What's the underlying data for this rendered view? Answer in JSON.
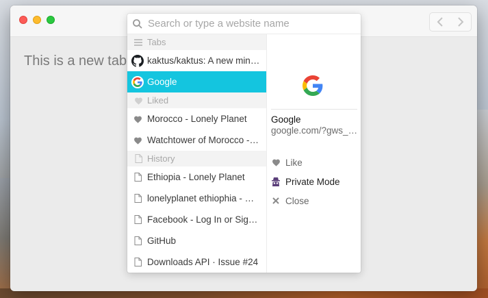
{
  "background": {
    "colors": [
      "#d9dde3",
      "#b9c3cf",
      "#8f8f8c",
      "#6b3e22"
    ]
  },
  "window": {
    "traffic_lights": {
      "close": "#fc5b57",
      "minimize": "#fdbb2e",
      "zoom": "#2ac840"
    },
    "nav": {
      "back_icon": "chevron-left-icon",
      "forward_icon": "chevron-right-icon"
    },
    "new_tab_text": "This is a new tab."
  },
  "search": {
    "placeholder": "Search or type a website name",
    "value": ""
  },
  "sections": {
    "tabs": {
      "label": "Tabs",
      "icon": "hamburger-icon"
    },
    "liked": {
      "label": "Liked",
      "icon": "heart-icon"
    },
    "history": {
      "label": "History",
      "icon": "document-icon"
    }
  },
  "tabs": [
    {
      "label": "kaktus/kaktus: A new minimal browser",
      "icon": "github-icon"
    },
    {
      "label": "Google",
      "icon": "google-icon",
      "selected": true
    }
  ],
  "liked": [
    {
      "label": "Morocco - Lonely Planet",
      "icon": "heart-icon"
    },
    {
      "label": "Watchtower of Morocco - Lonely Planet",
      "icon": "heart-icon"
    }
  ],
  "history": [
    {
      "label": "Ethiopia - Lonely Planet",
      "icon": "document-icon"
    },
    {
      "label": "lonelyplanet ethiophia - Google Search",
      "icon": "document-icon"
    },
    {
      "label": "Facebook - Log In or Sign Up",
      "icon": "document-icon"
    },
    {
      "label": "GitHub",
      "icon": "document-icon"
    },
    {
      "label": "Downloads API · Issue #24",
      "icon": "document-icon"
    }
  ],
  "preview": {
    "title": "Google",
    "url": "google.com/?gws_rd=ssl",
    "actions": {
      "like": {
        "label": "Like",
        "icon": "heart-icon"
      },
      "private": {
        "label": "Private Mode",
        "icon": "incognito-icon"
      },
      "close": {
        "label": "Close",
        "icon": "close-icon"
      }
    }
  },
  "colors": {
    "accent": "#14c5df",
    "section_bg": "#f3f3f3",
    "muted": "#a8a8a8"
  }
}
